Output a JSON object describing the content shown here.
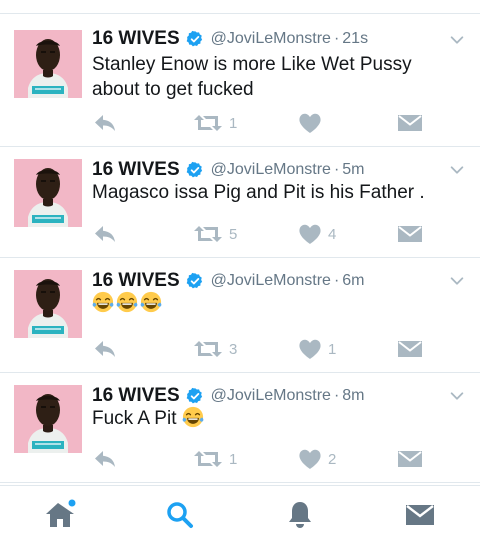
{
  "colors": {
    "text": "#14171a",
    "secondary": "#657786",
    "icon_gray": "#aab8c2",
    "verified_blue": "#1da1f2",
    "avatar_bg": "#f2b7c6",
    "tab_dark": "#667785",
    "tab_active": "#1da1f2"
  },
  "tweets": [
    {
      "name": "16 WIVES",
      "handle": "@JoviLeMonstre",
      "separator": "·",
      "time": "21s",
      "text": "Stanley Enow is more Like Wet Pussy about to get fucked",
      "retweets": "1",
      "likes": ""
    },
    {
      "name": "16 WIVES",
      "handle": "@JoviLeMonstre",
      "separator": "·",
      "time": "5m",
      "text": "Magasco issa Pig and Pit is his Father .",
      "retweets": "5",
      "likes": "4"
    },
    {
      "name": "16 WIVES",
      "handle": "@JoviLeMonstre",
      "separator": "·",
      "time": "6m",
      "emoji": [
        "face-with-tears-of-joy",
        "face-with-tears-of-joy",
        "face-with-tears-of-joy"
      ],
      "retweets": "3",
      "likes": "1"
    },
    {
      "name": "16 WIVES",
      "handle": "@JoviLeMonstre",
      "separator": "·",
      "time": "8m",
      "text": "Fuck A Pit",
      "text_emoji": "face-with-tears-of-joy",
      "retweets": "1",
      "likes": "2"
    }
  ],
  "icons": {
    "reply": "reply-icon",
    "retweet": "retweet-icon",
    "like": "heart-icon",
    "dm": "envelope-icon",
    "caret": "chevron-down-icon",
    "verified": "verified-badge-icon"
  },
  "tabbar": {
    "tabs": [
      "home-icon",
      "search-icon",
      "bell-icon",
      "envelope-icon"
    ],
    "active": "search-icon",
    "home_has_new_dot": true
  }
}
